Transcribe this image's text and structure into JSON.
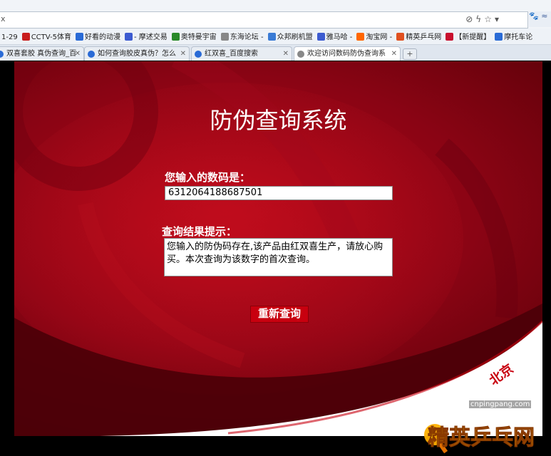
{
  "browser": {
    "url_left_text": "x",
    "right_panel_text": "🐾 ≈",
    "bookmarks": [
      {
        "label": "1-29",
        "color": ""
      },
      {
        "label": "CCTV-5体育",
        "color": "#c81d1d"
      },
      {
        "label": "好看的动漫",
        "color": "#2a6bd6"
      },
      {
        "label": "- 摩述交易",
        "color": "#3c5bd0"
      },
      {
        "label": "奥特曼宇宙",
        "color": "#2a8a2a"
      },
      {
        "label": "东海论坛 -",
        "color": "#888888"
      },
      {
        "label": "众邦刷机盟",
        "color": "#3a7bd5"
      },
      {
        "label": "雅马哈 -",
        "color": "#3c5bd0"
      },
      {
        "label": "淘宝网 -",
        "color": "#ff6600"
      },
      {
        "label": "精英乒乓网",
        "color": "#e05020"
      },
      {
        "label": "【新提醒】",
        "color": "#c8102e"
      },
      {
        "label": "摩托车论",
        "color": "#2a6bd6"
      }
    ],
    "tabs": [
      {
        "label": "双喜套胶 真伪查询_百",
        "color": "#2a6bd6",
        "active": false
      },
      {
        "label": "如何查询胶皮真伪？怎么",
        "color": "#2a6bd6",
        "active": false
      },
      {
        "label": "红双喜_百度搜索",
        "color": "#2a6bd6",
        "active": false
      },
      {
        "label": "欢迎访问数码防伪查询系",
        "color": "#888888",
        "active": true
      }
    ],
    "new_tab": "+"
  },
  "page": {
    "title": "防伪查询系统",
    "code_label": "您输入的数码是：",
    "code_value": "6312064188687501",
    "result_label": "查询结果提示：",
    "result_text": "您输入的防伪码存在,该产品由红双喜生产，请放心购买。本次查询为该数字的首次查询。",
    "requery_button": "重新查询",
    "stamp_text": "北京"
  },
  "watermark": {
    "text": "精英乒乓网",
    "url": "cnpingpang.com"
  }
}
